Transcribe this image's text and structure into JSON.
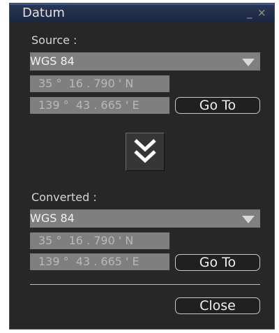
{
  "window": {
    "title": "Datum",
    "minimize_glyph": "_",
    "close_glyph": "×"
  },
  "source": {
    "label": "Source :",
    "datum": "WGS 84",
    "latitude": "35 °  16 . 790 ' N",
    "longitude": "139 °  43 . 665 ' E",
    "goto_label": "Go To"
  },
  "convert_button": {
    "icon": "double-chevron-down-icon"
  },
  "converted": {
    "label": "Converted :",
    "datum": "WGS 84",
    "latitude": "35 °  16 . 790 ' N",
    "longitude": "139 °  43 . 665 ' E",
    "goto_label": "Go To"
  },
  "footer": {
    "close_label": "Close"
  }
}
